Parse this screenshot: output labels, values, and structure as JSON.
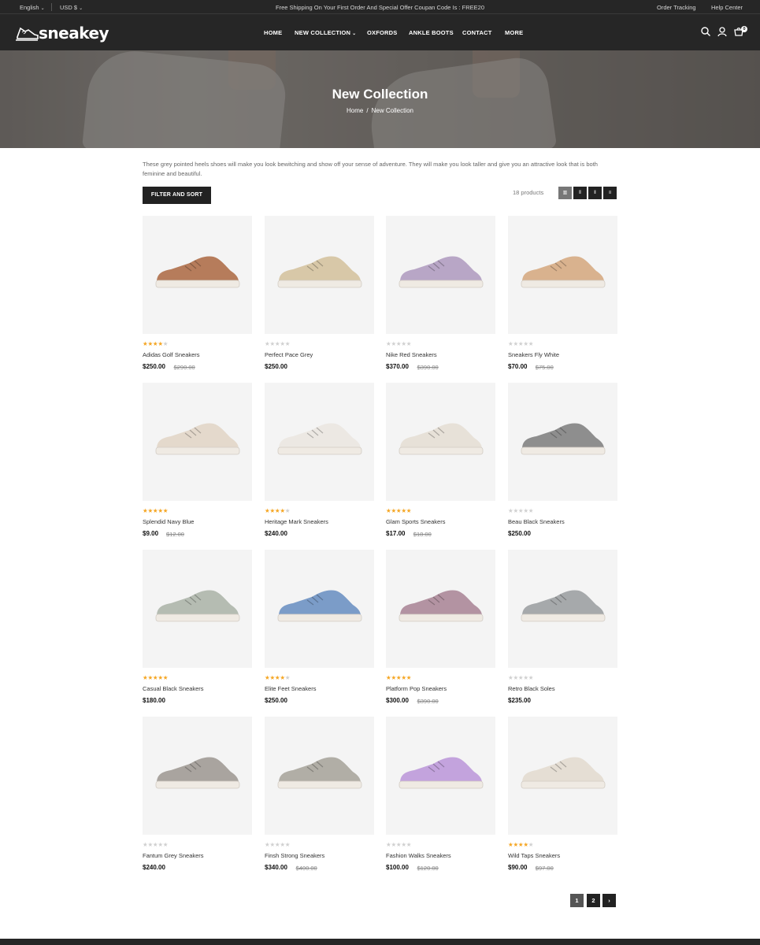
{
  "topbar": {
    "language": "English",
    "currency": "USD $",
    "promo": "Free Shipping On Your First Order And Special Offer Coupan Code Is : FREE20",
    "order_tracking": "Order Tracking",
    "help_center": "Help Center"
  },
  "header": {
    "logo": "sneakey",
    "nav": [
      "HOME",
      "NEW COLLECTION",
      "OXFORDS",
      "ANKLE BOOTS",
      "CONTACT",
      "MORE"
    ],
    "cart_count": "0",
    "icons": [
      "search-icon",
      "user-icon",
      "cart-icon"
    ]
  },
  "hero": {
    "title": "New Collection",
    "breadcrumb_home": "Home",
    "breadcrumb_sep": "/",
    "breadcrumb_current": "New Collection"
  },
  "collection": {
    "description": "These grey pointed heels shoes will make you look bewitching and show off your sense of adventure. They will make you look taller and give you an attractive look that is both feminine and beautiful.",
    "filter_label": "FILTER AND SORT",
    "product_count": "18 products",
    "view_icons": [
      "grid-4-icon",
      "grid-3-icon",
      "grid-2-icon",
      "list-icon"
    ]
  },
  "colors": {
    "dark": "#262626",
    "star": "#f5a623",
    "card_bg": "#f4f4f4"
  },
  "products": [
    {
      "name": "Adidas Golf Sneakers",
      "price": "$250.00",
      "old_price": "$290.00",
      "rating": 4,
      "color": "#b67c5b"
    },
    {
      "name": "Perfect Pace Grey",
      "price": "$250.00",
      "old_price": "",
      "rating": 0,
      "color": "#d8c8a8"
    },
    {
      "name": "Nike Red Sneakers",
      "price": "$370.00",
      "old_price": "$390.00",
      "rating": 0,
      "color": "#b8a6c6"
    },
    {
      "name": "Sneakers Fly White",
      "price": "$70.00",
      "old_price": "$75.00",
      "rating": 0,
      "color": "#d9b28e"
    },
    {
      "name": "Splendid Navy Blue",
      "price": "$9.00",
      "old_price": "$12.00",
      "rating": 5,
      "color": "#e4d9cc"
    },
    {
      "name": "Heritage Mark Sneakers",
      "price": "$240.00",
      "old_price": "",
      "rating": 4,
      "color": "#ece8e3"
    },
    {
      "name": "Glam Sports Sneakers",
      "price": "$17.00",
      "old_price": "$18.00",
      "rating": 5,
      "color": "#e7e1d8"
    },
    {
      "name": "Beau Black Sneakers",
      "price": "$250.00",
      "old_price": "",
      "rating": 0,
      "color": "#8e8e8e"
    },
    {
      "name": "Casual Black Sneakers",
      "price": "$180.00",
      "old_price": "",
      "rating": 5,
      "color": "#b5bcb2"
    },
    {
      "name": "Elite Feet Sneakers",
      "price": "$250.00",
      "old_price": "",
      "rating": 4,
      "color": "#7b9cc8"
    },
    {
      "name": "Platform Pop Sneakers",
      "price": "$300.00",
      "old_price": "$390.00",
      "rating": 5,
      "color": "#b393a2"
    },
    {
      "name": "Retro Black Soles",
      "price": "$235.00",
      "old_price": "",
      "rating": 0,
      "color": "#a6a9ab"
    },
    {
      "name": "Fantum Grey Sneakers",
      "price": "$240.00",
      "old_price": "",
      "rating": 0,
      "color": "#a9a49f"
    },
    {
      "name": "Finsh Strong Sneakers",
      "price": "$340.00",
      "old_price": "$400.00",
      "rating": 0,
      "color": "#b1aea6"
    },
    {
      "name": "Fashion Walks Sneakers",
      "price": "$100.00",
      "old_price": "$120.00",
      "rating": 0,
      "color": "#c3a3dd"
    },
    {
      "name": "Wild Taps Sneakers",
      "price": "$90.00",
      "old_price": "$97.00",
      "rating": 4,
      "color": "#e5ded4"
    }
  ],
  "pagination": {
    "pages": [
      "1",
      "2"
    ],
    "next": "›"
  }
}
